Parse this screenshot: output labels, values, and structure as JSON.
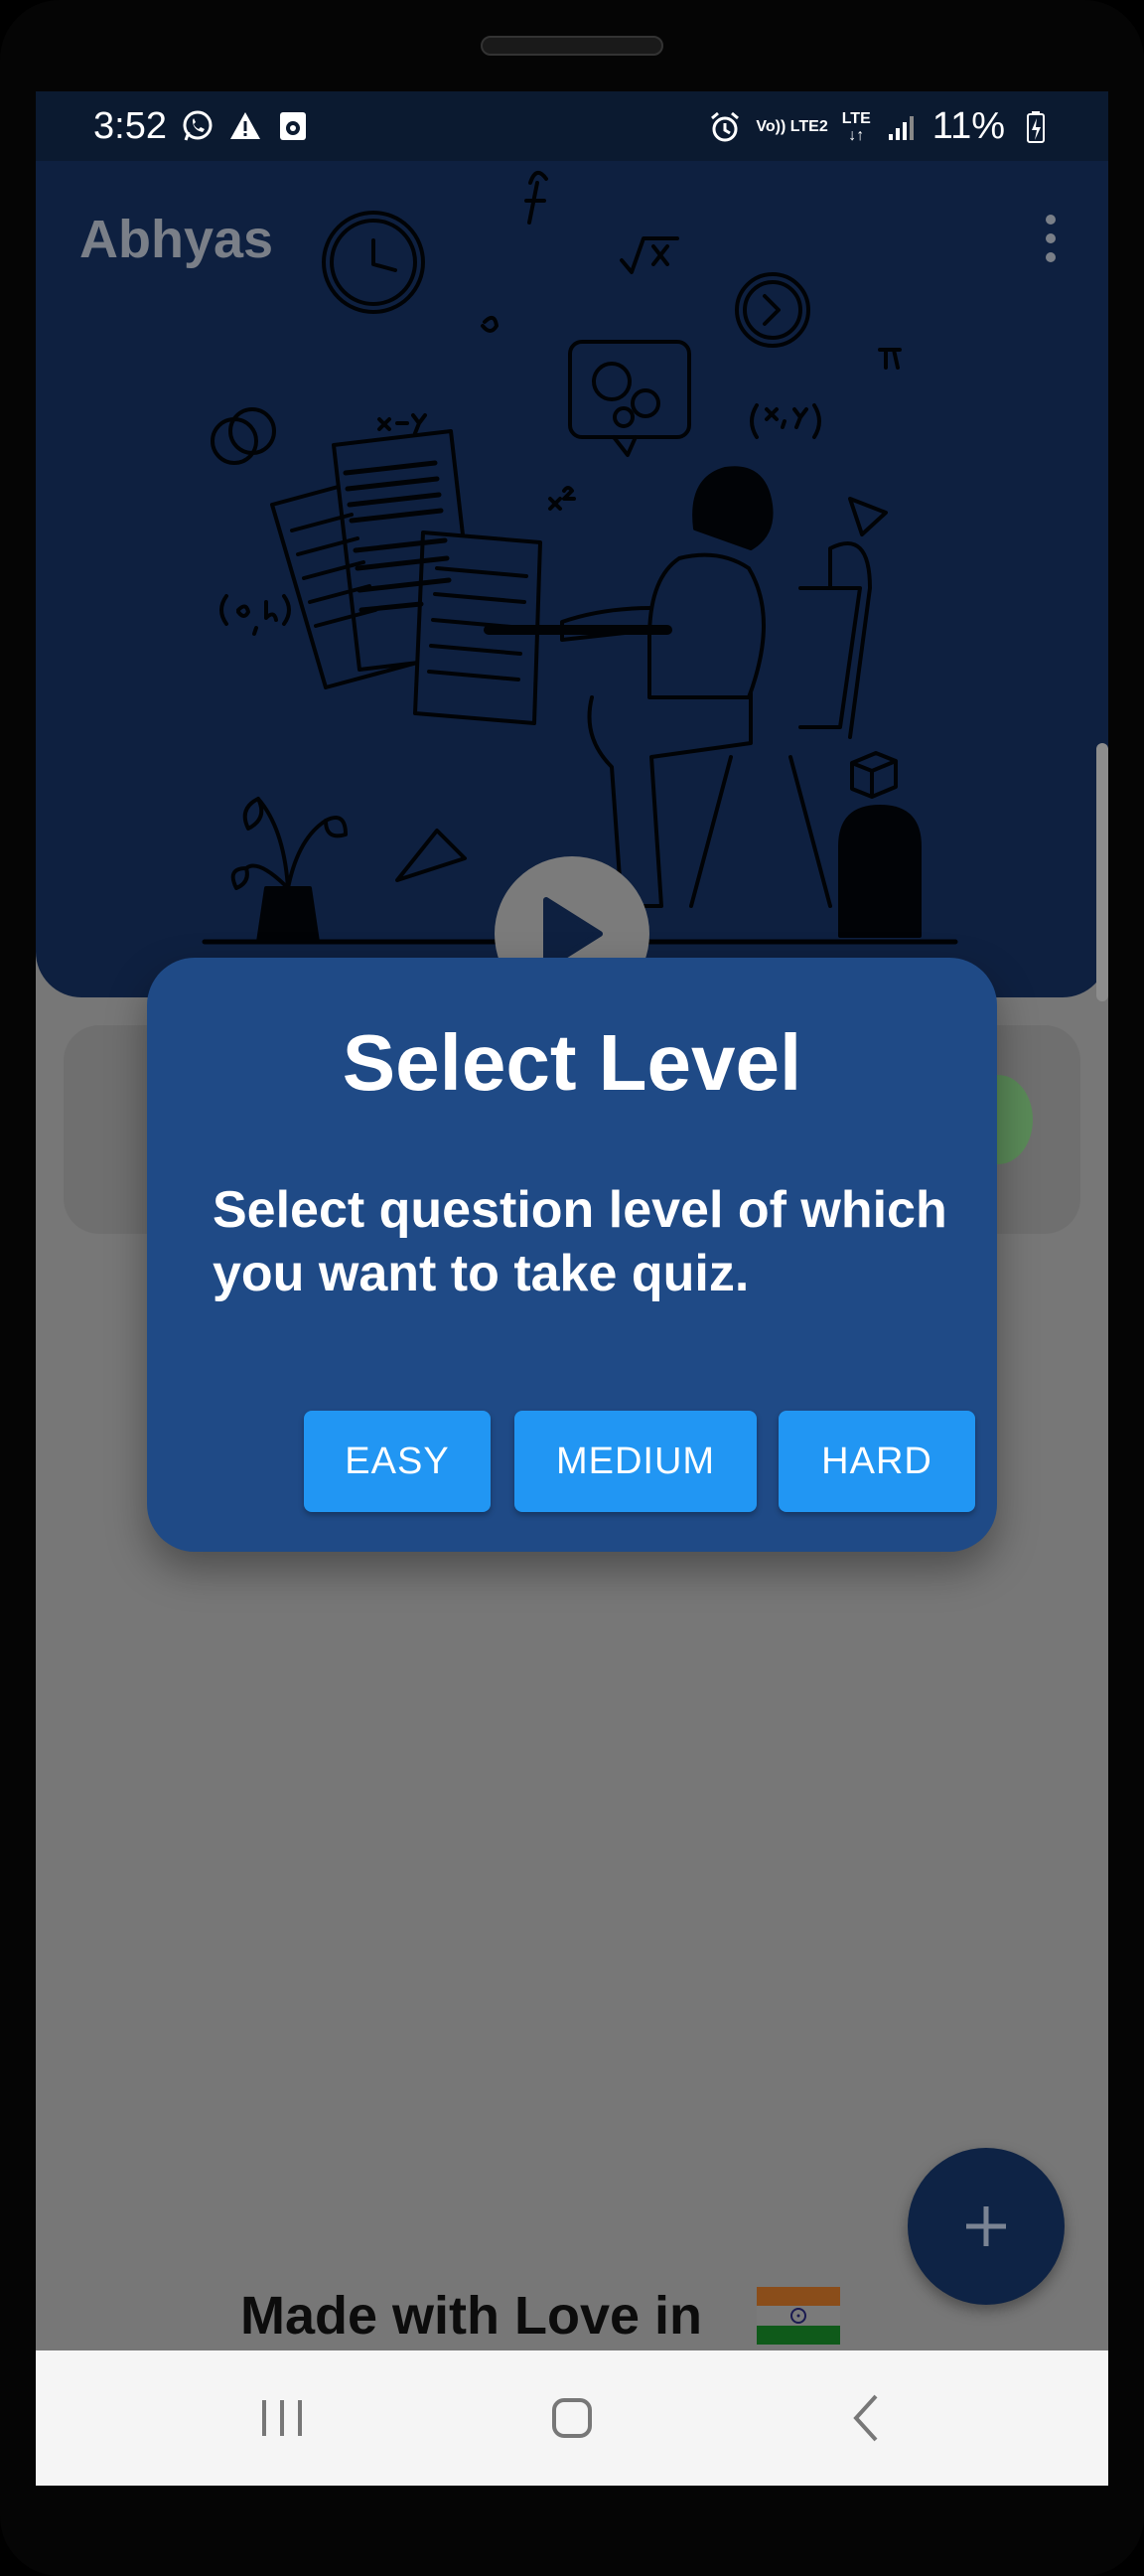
{
  "status_bar": {
    "time": "3:52",
    "left_icons": [
      "whatsapp-icon",
      "warning-icon",
      "camera-icon"
    ],
    "right_icons": [
      "alarm-icon",
      "volte-icon",
      "signal-icon",
      "battery-charging-icon"
    ],
    "network_top": "Vo)) LTE2",
    "lte": "LTE",
    "battery": "11%"
  },
  "app_bar": {
    "title": "Abhyas",
    "menu_icon": "more-vert-icon"
  },
  "hero": {
    "play_icon": "play-icon"
  },
  "dialog": {
    "title": "Select Level",
    "message": "Select question level of which you want to take quiz.",
    "buttons": [
      {
        "label": "EASY"
      },
      {
        "label": "MEDIUM"
      },
      {
        "label": "HARD"
      }
    ]
  },
  "fab": {
    "icon": "plus-icon"
  },
  "footer": {
    "text": "Made with Love in",
    "flag": "india-flag-icon"
  },
  "nav_bar": {
    "icons": [
      "recents-icon",
      "home-icon",
      "back-icon"
    ]
  },
  "colors": {
    "dialog_bg": "#1f4a86",
    "button_bg": "#2196f3",
    "header_bg": "#0e2040",
    "scrim": "#777777"
  }
}
